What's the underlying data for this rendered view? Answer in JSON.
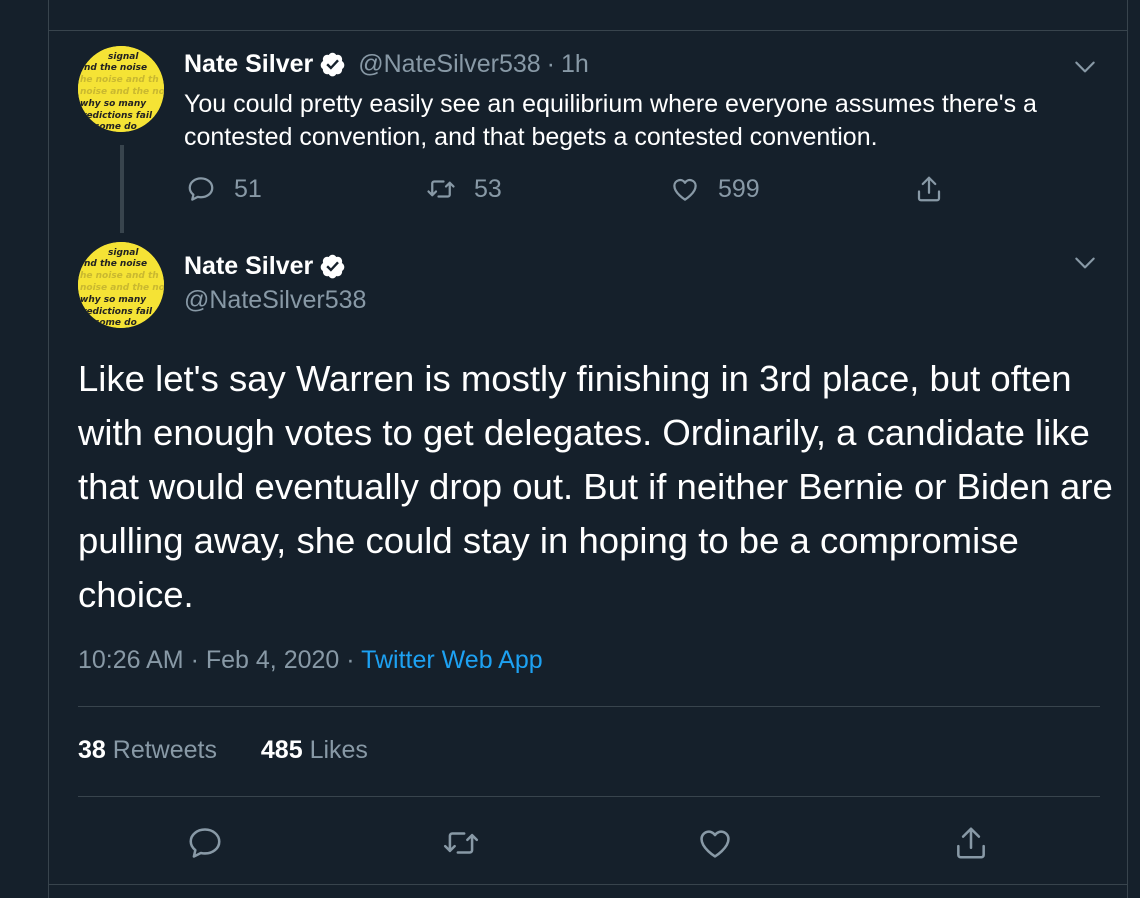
{
  "parent_tweet": {
    "name": "Nate Silver",
    "handle": "@NateSilver538",
    "separator": "·",
    "time": "1h",
    "text": "You could pretty easily see an equilibrium where everyone assumes there's a contested convention, and that begets a contested convention.",
    "reply_count": "51",
    "retweet_count": "53",
    "like_count": "599"
  },
  "main_tweet": {
    "name": "Nate Silver",
    "handle": "@NateSilver538",
    "text": "Like let's say Warren is mostly finishing in 3rd place, but often with enough votes to get delegates. Ordinarily, a candidate like that would eventually drop out. But if neither Bernie or Biden are pulling away, she could stay in hoping to be a compromise choice.",
    "time": "10:26 AM",
    "date": "Feb 4, 2020",
    "separator": "·",
    "source": "Twitter Web App",
    "retweets_count": "38",
    "retweets_label": "Retweets",
    "likes_count": "485",
    "likes_label": "Likes"
  },
  "avatar_text": [
    "signal",
    "nd the noise",
    "he noise and th",
    "noise and the no",
    "why so many",
    "redictions fail",
    "some do"
  ],
  "colors": {
    "background": "#15202b",
    "border": "#38444d",
    "secondary_text": "#8899a6",
    "accent": "#1da1f2",
    "avatar_bg": "#f5e335"
  },
  "icons": [
    "verified-badge-icon",
    "chevron-down-icon",
    "reply-icon",
    "retweet-icon",
    "like-icon",
    "share-icon"
  ]
}
